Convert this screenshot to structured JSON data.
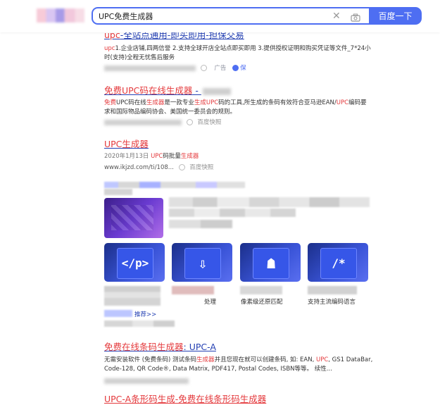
{
  "header": {
    "query": "UPC免费生成器",
    "search_button": "百度一下"
  },
  "results": [
    {
      "title_pre": "",
      "title_em": "upc",
      "title_post": "-全站点通用-即买即用-担保交易",
      "snippet_lead": "upc",
      "snippet": "1.企业店铺,四两信誉 2.支持全球开店全站点即买即用 3.提供授权证明和购买凭证等文件_7*24小时(支持)全程无忧售后服务",
      "ad": "广告",
      "bao": "保"
    },
    {
      "title_pre": "",
      "title_em": "免费UPC码在线生成器",
      "title_post": " - ",
      "snippet_parts": [
        "免费",
        "UPC码在线",
        "生成器",
        "是一款专业",
        "生成",
        "UPC",
        "码的工具,所生成的条码有效符合亚马逊EAN/",
        "UPC",
        "编码要求和国际物品编码协会、美国统一委员会的规则。"
      ],
      "kuaizhao": "百度快照"
    },
    {
      "title_em": "UPC生成器",
      "date": "2020年1月13日",
      "snippet_a": "UPC",
      "snippet_b": "码批量",
      "snippet_c": "生成器",
      "url": "www.ikjzd.com/ti/108...",
      "kuaizhao": "百度快照"
    }
  ],
  "tools": {
    "captions": [
      "",
      "处理",
      "像素级还原匹配",
      "支持主流编码语言"
    ],
    "more": "推荐>>",
    "card_glyphs": [
      "</p>",
      "⇩",
      "☗",
      "/*"
    ]
  },
  "results2": [
    {
      "title_em": "免费在线条码生成器",
      "title_post": ": UPC-A",
      "snippet_pre": "无需安装软件 (免费条码) 测试条码",
      "snippet_em1": "生成器",
      "snippet_mid": "并且您现在就可以创建条码, 如: EAN, ",
      "snippet_em2": "UPC",
      "snippet_post": ", GS1 DataBar, Code-128, QR Code®, Data Matrix, PDF417, Postal Codes, ISBN等等。 续性..."
    },
    {
      "title": "UPC-A条形码生成-免费在线条形码生成器"
    }
  ],
  "colors": {
    "accent": "#4e6ef2",
    "link": "#2440b3",
    "highlight": "#e4393c"
  },
  "icons": [
    "clear-icon",
    "camera-icon",
    "snapshot-dot-icon",
    "bao-icon"
  ]
}
